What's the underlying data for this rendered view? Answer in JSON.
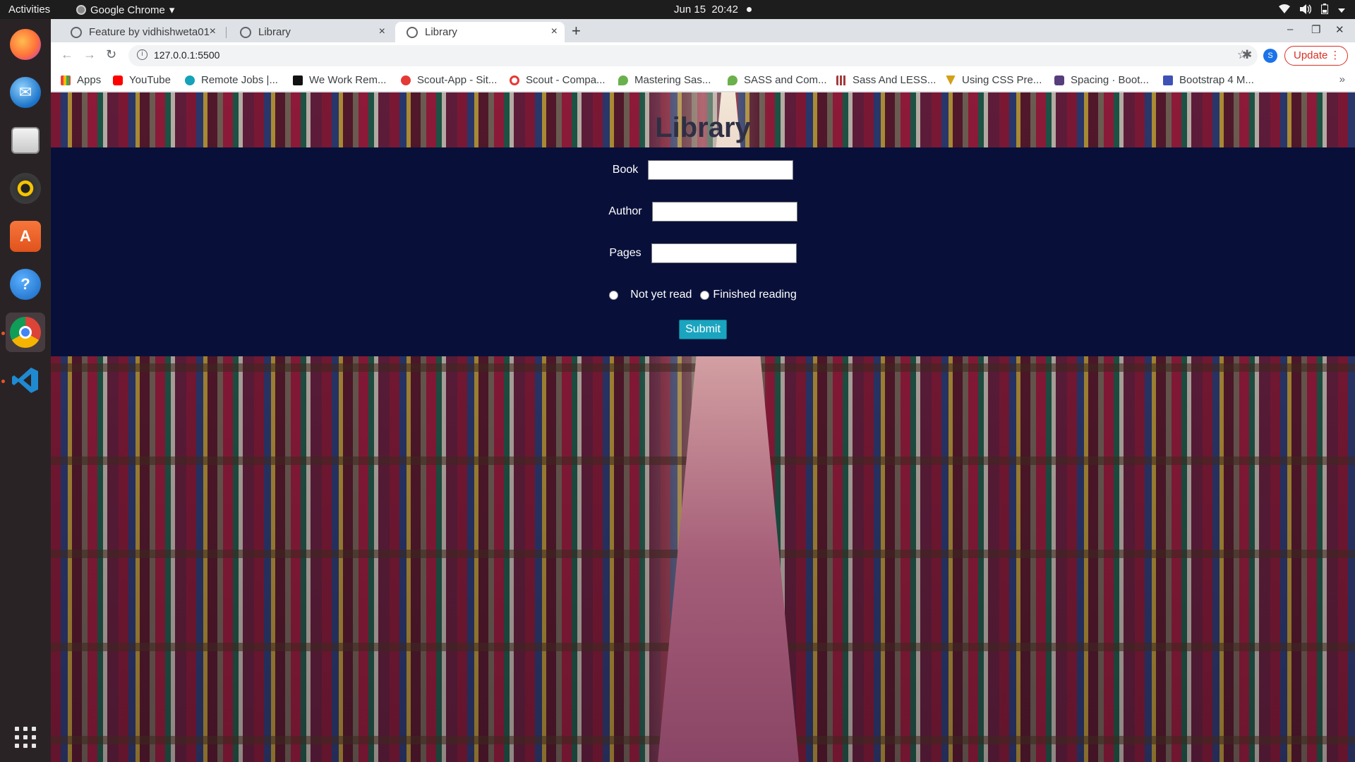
{
  "topbar": {
    "activities": "Activities",
    "app_name": "Google Chrome",
    "app_arrow": "▾",
    "date": "Jun 15",
    "time": "20:42",
    "icons": [
      "wifi-icon",
      "volume-icon",
      "battery-icon",
      "system-menu-icon"
    ]
  },
  "dock": {
    "items": [
      "firefox",
      "thunderbird",
      "files",
      "rhythmbox",
      "software-center",
      "help",
      "chrome",
      "vscode"
    ],
    "apps_label": "show-applications"
  },
  "tabs": [
    {
      "title": "Feature by vidhishweta01",
      "close": "×"
    },
    {
      "title": "Library",
      "close": "×"
    },
    {
      "title": "Library",
      "close": "×",
      "active": true
    }
  ],
  "newtab": "+",
  "window_controls": {
    "minimize": "–",
    "restore": "❐",
    "close": "✕"
  },
  "toolbar": {
    "back": "←",
    "forward": "→",
    "reload": "↻",
    "info": "i",
    "url": "127.0.0.1:5500",
    "star": "☆",
    "extensions": "✱",
    "profile": "S",
    "update": "Update",
    "more": "⋮"
  },
  "bookmarks": [
    {
      "label": "Apps",
      "color": "#4285f4"
    },
    {
      "label": "YouTube",
      "color": "#ff0000"
    },
    {
      "label": "Remote Jobs |...",
      "color": "#16a2b8"
    },
    {
      "label": "We Work Rem...",
      "color": "#111111"
    },
    {
      "label": "Scout-App - Sit...",
      "color": "#e53935"
    },
    {
      "label": "Scout - Compa...",
      "color": "#e53935"
    },
    {
      "label": "Mastering Sas...",
      "color": "#6ab04c"
    },
    {
      "label": "SASS and Com...",
      "color": "#6ab04c"
    },
    {
      "label": "Sass And LESS...",
      "color": "#a33b3b"
    },
    {
      "label": "Using CSS Pre...",
      "color": "#d4a017"
    },
    {
      "label": "Spacing · Boot...",
      "color": "#563d7c"
    },
    {
      "label": "Bootstrap 4 M...",
      "color": "#3f51b5"
    }
  ],
  "bookmarks_more": "»",
  "page": {
    "title": "Library",
    "form": {
      "book_label": "Book",
      "author_label": "Author",
      "pages_label": "Pages",
      "book_value": "",
      "author_value": "",
      "pages_value": "",
      "radio_not_read": "Not yet read",
      "radio_finished": "Finished reading",
      "submit": "Submit"
    },
    "panel_color": "#08103a",
    "button_color": "#1aa4bf"
  }
}
